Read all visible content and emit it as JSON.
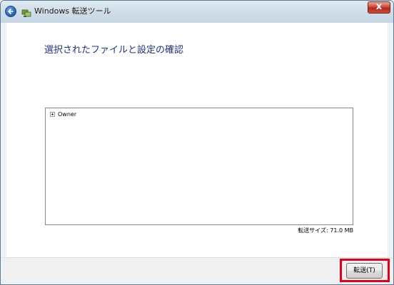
{
  "titlebar": {
    "title": "Windows 転送ツール",
    "back_icon": "back-arrow-icon",
    "app_icon": "transfer-tool-icon",
    "close_label": "x"
  },
  "main": {
    "heading": "選択されたファイルと設定の確認",
    "tree": {
      "items": [
        {
          "label": "Owner",
          "expander": "+"
        }
      ]
    },
    "transfer_size": "転送サイズ: 71.0 MB"
  },
  "footer": {
    "transfer_button_label": "転送(T)"
  },
  "colors": {
    "heading": "#1e3287",
    "highlight": "#e3001b"
  }
}
